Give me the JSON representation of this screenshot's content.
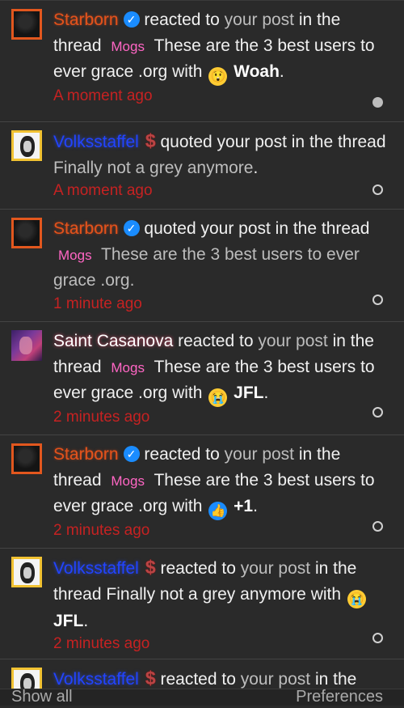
{
  "notifications": [
    {
      "user": "Starborn",
      "verb": "reacted to",
      "object": "your post",
      "ctx": "in the thread",
      "tag": "Mogs",
      "thread": "These are the 3 best users to ever grace .org",
      "with": "with",
      "emoji_icon": "astonished-emoji-icon",
      "reaction": "Woah",
      "time": "A moment ago",
      "unread": true
    },
    {
      "user": "Volksstaffel",
      "verb": "quoted your post in the thread",
      "thread": "Finally not a grey anymore",
      "time": "A moment ago",
      "unread": false
    },
    {
      "user": "Starborn",
      "verb": "quoted your post in the thread",
      "tag": "Mogs",
      "thread": "These are the 3 best users to ever grace .org",
      "time": "1 minute ago",
      "unread": false
    },
    {
      "user": "Saint Casanova",
      "verb": "reacted to",
      "object": "your post",
      "ctx": "in the thread",
      "tag": "Mogs",
      "thread": "These are the 3 best users to ever grace .org",
      "with": "with",
      "emoji_icon": "crying-emoji-icon",
      "reaction": "JFL",
      "time": "2 minutes ago",
      "unread": false
    },
    {
      "user": "Starborn",
      "verb": "reacted to",
      "object": "your post",
      "ctx": "in the thread",
      "tag": "Mogs",
      "thread": "These are the 3 best users to ever grace .org",
      "with": "with",
      "emoji_icon": "thumbs-up-icon",
      "reaction": "+1",
      "time": "2 minutes ago",
      "unread": false
    },
    {
      "user": "Volksstaffel",
      "verb": "reacted to",
      "object": "your post",
      "ctx": "in the thread",
      "thread": "Finally not a grey anymore",
      "with": "with",
      "emoji_icon": "crying-emoji-icon",
      "reaction": "JFL",
      "time": "2 minutes ago",
      "unread": false
    },
    {
      "user": "Volksstaffel",
      "verb": "reacted to",
      "object": "your post",
      "ctx": "in the"
    }
  ],
  "footer": {
    "show_all": "Show all",
    "preferences": "Preferences"
  },
  "colors": {
    "time_red": "#c62222",
    "tag_pink": "#ff66c4",
    "username_orange": "#e0521c",
    "username_blue": "#2244ff",
    "background": "#2a2a2a"
  }
}
